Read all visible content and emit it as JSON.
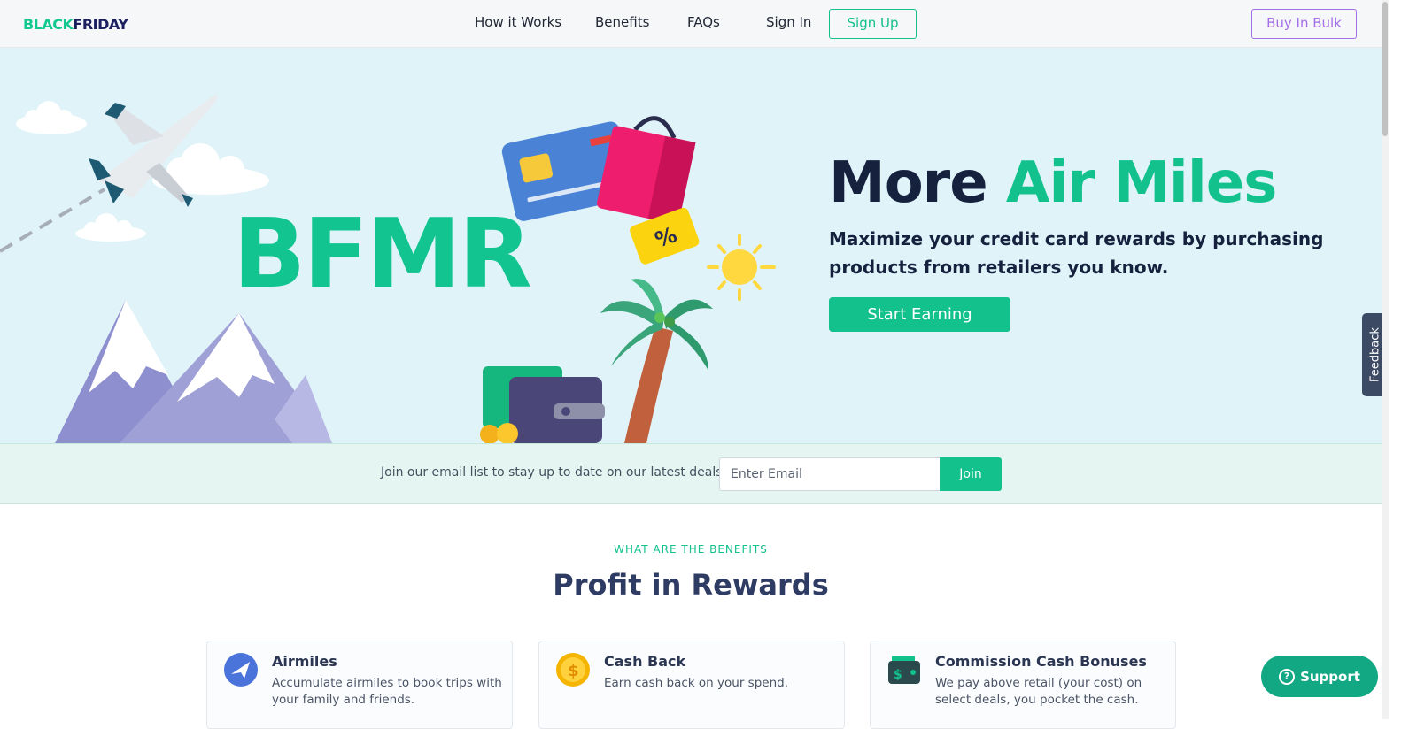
{
  "nav": {
    "logo_part1": "BLACK",
    "logo_part2": "FRIDAY",
    "links": [
      "How it Works",
      "Benefits",
      "FAQs",
      "Sign In"
    ],
    "signup_label": "Sign Up",
    "bulk_label": "Buy In Bulk"
  },
  "hero": {
    "brand": "BFMR",
    "headline_lead": "More ",
    "headline_accent": "Air Miles",
    "subtitle": "Maximize your credit card rewards by purchasing products from retailers you know.",
    "cta_label": "Start Earning"
  },
  "email": {
    "prompt": "Join our email list to stay up to date on our latest deals",
    "placeholder": "Enter Email",
    "join_label": "Join"
  },
  "benefits": {
    "kicker": "WHAT ARE THE BENEFITS",
    "title": "Profit in Rewards",
    "cards": [
      {
        "title": "Airmiles",
        "text": "Accumulate airmiles to book trips with your family and friends.",
        "icon": "airplane-icon"
      },
      {
        "title": "Cash Back",
        "text": "Earn cash back on your spend.",
        "icon": "coin-icon"
      },
      {
        "title": "Commission Cash Bonuses",
        "text": "We pay above retail (your cost) on select deals, you pocket the cash.",
        "icon": "wallet-icon"
      }
    ]
  },
  "widgets": {
    "feedback_label": "Feedback",
    "support_label": "Support",
    "support_icon": "?"
  },
  "colors": {
    "accent": "#12c18b",
    "purple": "#a46ee6",
    "navy": "#16213e",
    "hero_bg": "#dff3f9"
  }
}
